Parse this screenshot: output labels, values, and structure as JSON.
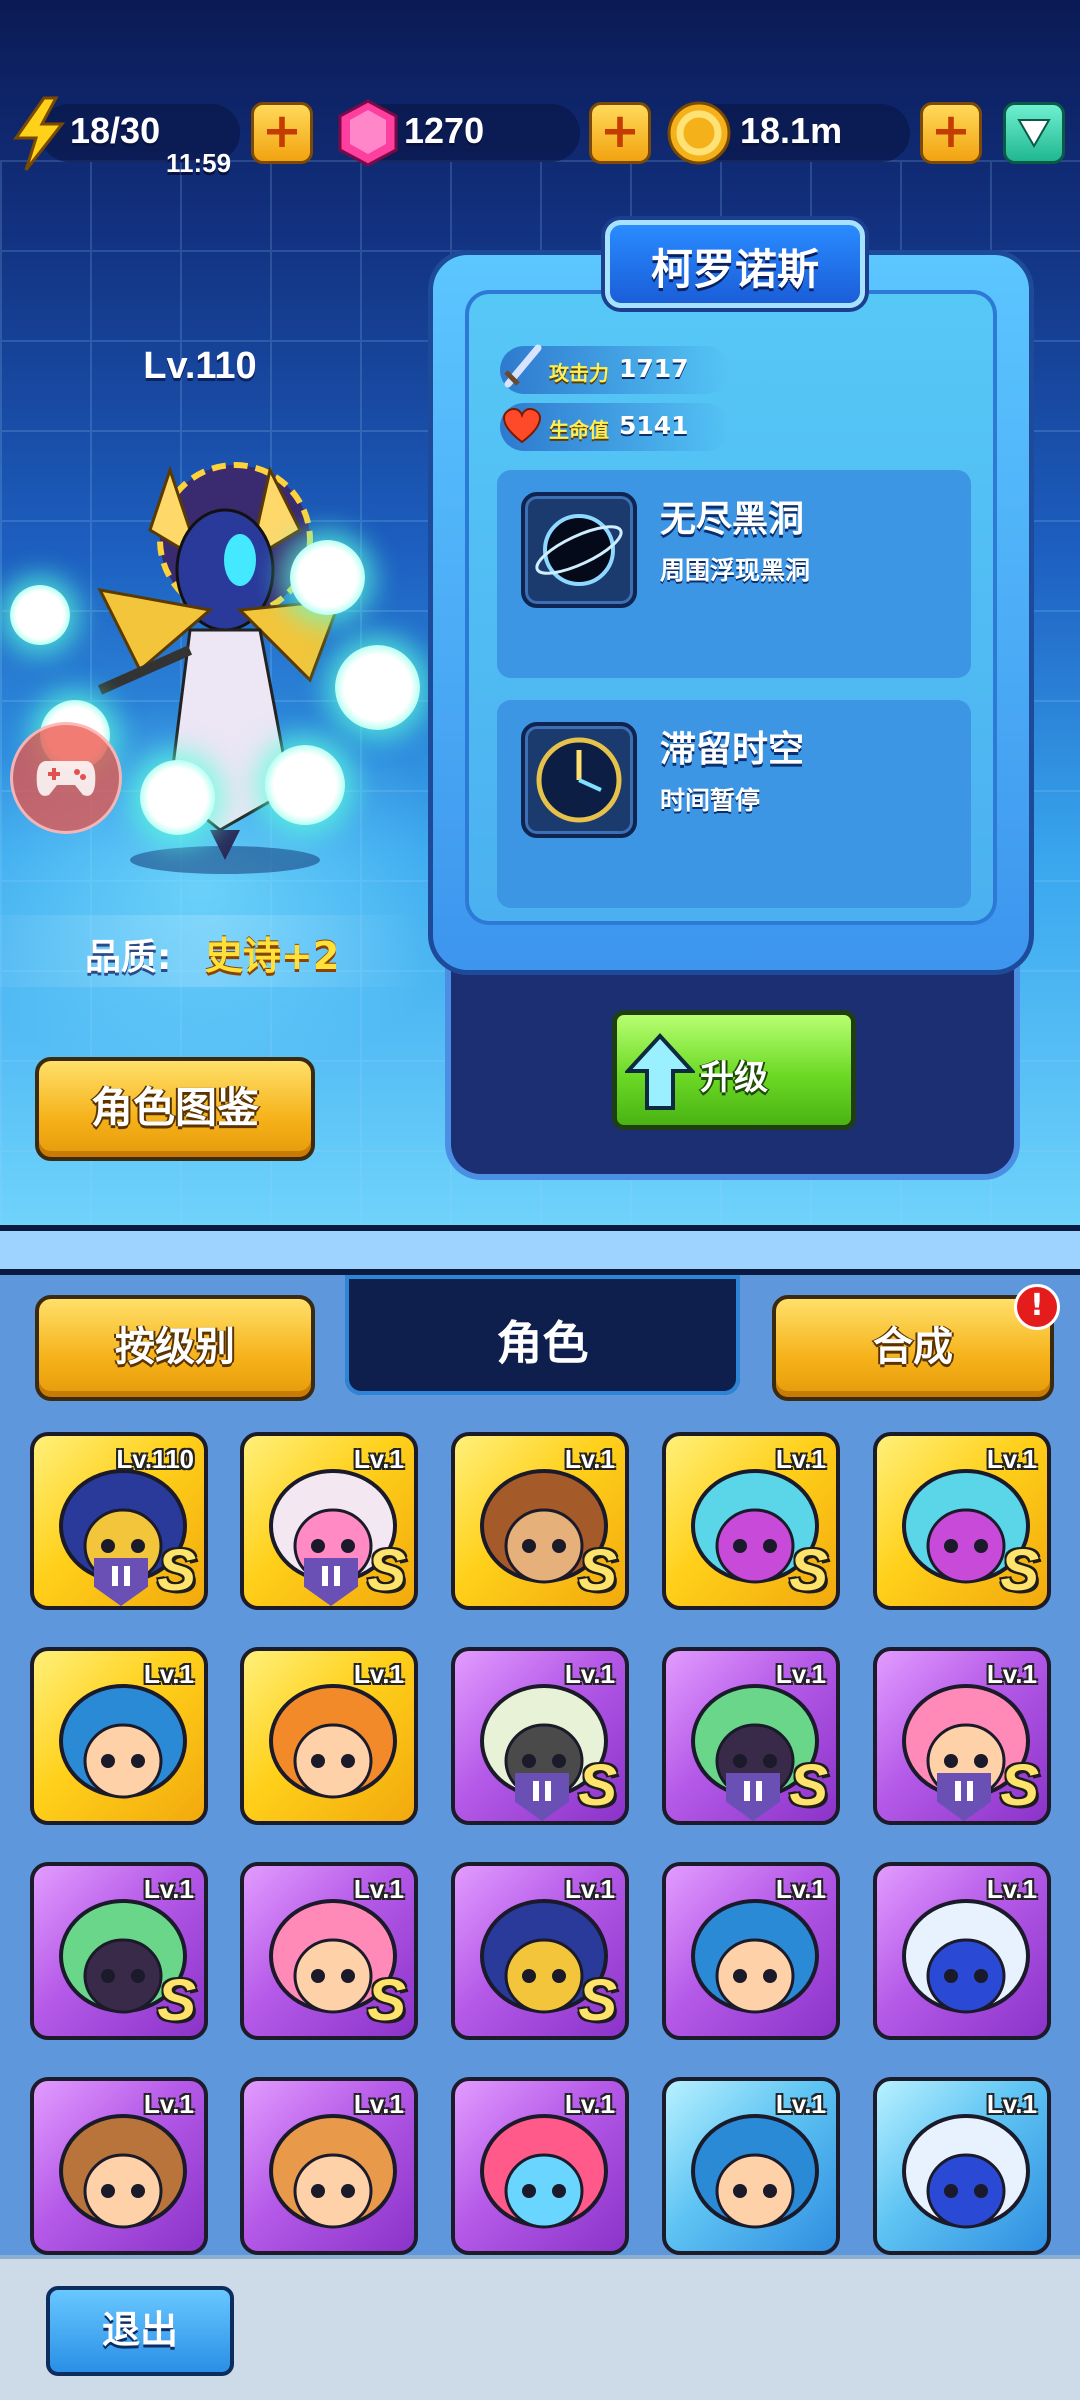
{
  "resources": {
    "energy": {
      "value": "18/30",
      "timer": "11:59",
      "icon": "lightning-icon"
    },
    "gems": {
      "value": "1270",
      "icon": "pink-gem-icon"
    },
    "coins": {
      "value": "18.1m",
      "icon": "gold-coin-icon"
    },
    "plus_label": "+"
  },
  "hero": {
    "name": "柯罗诺斯",
    "level": "Lv.110",
    "quality_label": "品质:",
    "quality_value": "史诗+2",
    "stats": [
      {
        "label": "攻击力",
        "value": "1717",
        "icon": "sword-icon"
      },
      {
        "label": "生命值",
        "value": "5141",
        "icon": "heart-icon"
      }
    ],
    "skills": [
      {
        "name": "无尽黑洞",
        "desc": "周围浮现黑洞",
        "icon": "black-hole-icon"
      },
      {
        "name": "滞留时空",
        "desc": "时间暂停",
        "icon": "clock-icon"
      }
    ],
    "upgrade_label": "升级",
    "codex_label": "角色图鉴"
  },
  "tabs": {
    "sort_label": "按级别",
    "active_label": "角色",
    "merge_label": "合成",
    "alert": "!"
  },
  "roster": [
    {
      "level": "Lv.110",
      "rarity": "gold",
      "grade": "S",
      "paused": true,
      "portrait": "chronos-head"
    },
    {
      "level": "Lv.1",
      "rarity": "gold",
      "grade": "S",
      "paused": true,
      "portrait": "white-hair-girl-head"
    },
    {
      "level": "Lv.1",
      "rarity": "gold",
      "grade": "S",
      "paused": false,
      "portrait": "lion-monkey-head"
    },
    {
      "level": "Lv.1",
      "rarity": "gold",
      "grade": "S",
      "paused": false,
      "portrait": "clown-girl-head"
    },
    {
      "level": "Lv.1",
      "rarity": "gold",
      "grade": "S",
      "paused": false,
      "portrait": "clown-girl-head"
    },
    {
      "level": "Lv.1",
      "rarity": "gold",
      "grade": "",
      "paused": false,
      "portrait": "blue-hood-girl-head"
    },
    {
      "level": "Lv.1",
      "rarity": "gold",
      "grade": "",
      "paused": false,
      "portrait": "bun-hair-girl-head"
    },
    {
      "level": "Lv.1",
      "rarity": "purple",
      "grade": "S",
      "paused": true,
      "portrait": "horned-girl-head"
    },
    {
      "level": "Lv.1",
      "rarity": "purple",
      "grade": "S",
      "paused": true,
      "portrait": "chain-horn-girl-head"
    },
    {
      "level": "Lv.1",
      "rarity": "purple",
      "grade": "S",
      "paused": true,
      "portrait": "pink-beanie-girl-head"
    },
    {
      "level": "Lv.1",
      "rarity": "purple",
      "grade": "S",
      "paused": false,
      "portrait": "chain-horn-girl-head"
    },
    {
      "level": "Lv.1",
      "rarity": "purple",
      "grade": "S",
      "paused": false,
      "portrait": "pink-beanie-girl-head"
    },
    {
      "level": "Lv.1",
      "rarity": "purple",
      "grade": "S",
      "paused": false,
      "portrait": "chronos-head"
    },
    {
      "level": "Lv.1",
      "rarity": "purple",
      "grade": "",
      "paused": false,
      "portrait": "blue-hood-girl-head"
    },
    {
      "level": "Lv.1",
      "rarity": "purple",
      "grade": "",
      "paused": false,
      "portrait": "white-hair-headphone-head"
    },
    {
      "level": "Lv.1",
      "rarity": "purple",
      "grade": "",
      "paused": false,
      "portrait": "cowboy-head"
    },
    {
      "level": "Lv.1",
      "rarity": "purple",
      "grade": "",
      "paused": false,
      "portrait": "bearded-man-head"
    },
    {
      "level": "Lv.1",
      "rarity": "purple",
      "grade": "",
      "paused": false,
      "portrait": "pink-hair-goggles-head"
    },
    {
      "level": "Lv.1",
      "rarity": "blue",
      "grade": "",
      "paused": false,
      "portrait": "blue-hood-girl-head"
    },
    {
      "level": "Lv.1",
      "rarity": "blue",
      "grade": "",
      "paused": false,
      "portrait": "white-hair-headphone-head"
    }
  ],
  "exit_label": "退出",
  "colors": {
    "gold": "#ffd01a",
    "purple": "#b55ae8",
    "blue": "#5fc4f3",
    "accent_green": "#6cd925"
  }
}
